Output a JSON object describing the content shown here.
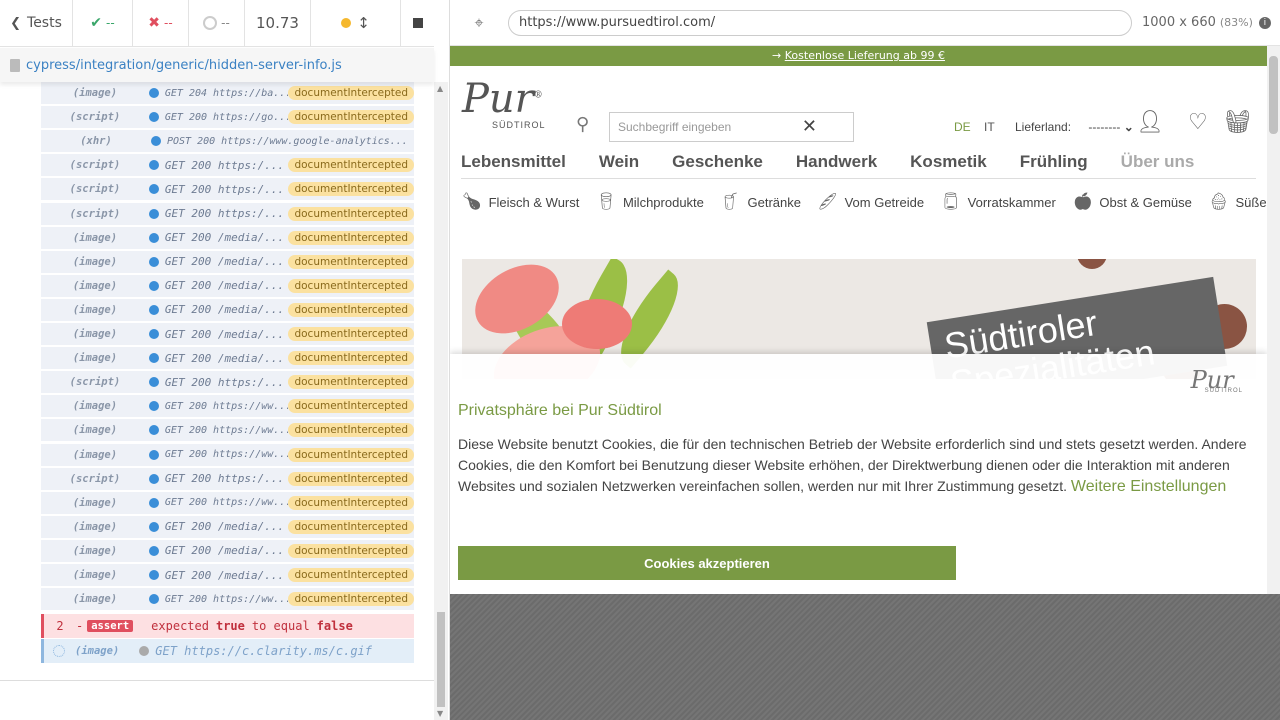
{
  "runner": {
    "tests_label": "Tests",
    "passed": "--",
    "failed": "--",
    "pending": "--",
    "duration": "10.73",
    "spec_path": "cypress/integration/generic/hidden-server-info.js"
  },
  "commands": [
    {
      "kind": "(image)",
      "req": "GET 204 https://ba...",
      "badge": "documentIntercepted",
      "small": true
    },
    {
      "kind": "(script)",
      "req": "GET 200 https://go...",
      "badge": "documentIntercepted",
      "small": true
    },
    {
      "kind": "(xhr)",
      "req": "POST 200 https://www.google-analytics...",
      "badge": "",
      "small": true
    },
    {
      "kind": "(script)",
      "req": "GET 200 https:/...",
      "badge": "documentIntercepted",
      "small": false
    },
    {
      "kind": "(script)",
      "req": "GET 200 https:/...",
      "badge": "documentIntercepted",
      "small": false
    },
    {
      "kind": "(script)",
      "req": "GET 200 https:/...",
      "badge": "documentIntercepted",
      "small": false
    },
    {
      "kind": "(image)",
      "req": "GET 200 /media/...",
      "badge": "documentIntercepted",
      "small": false
    },
    {
      "kind": "(image)",
      "req": "GET 200 /media/...",
      "badge": "documentIntercepted",
      "small": false
    },
    {
      "kind": "(image)",
      "req": "GET 200 /media/...",
      "badge": "documentIntercepted",
      "small": false
    },
    {
      "kind": "(image)",
      "req": "GET 200 /media/...",
      "badge": "documentIntercepted",
      "small": false
    },
    {
      "kind": "(image)",
      "req": "GET 200 /media/...",
      "badge": "documentIntercepted",
      "small": false
    },
    {
      "kind": "(image)",
      "req": "GET 200 /media/...",
      "badge": "documentIntercepted",
      "small": false
    },
    {
      "kind": "(script)",
      "req": "GET 200 https:/...",
      "badge": "documentIntercepted",
      "small": false
    },
    {
      "kind": "(image)",
      "req": "GET 200 https://ww...",
      "badge": "documentIntercepted",
      "small": true
    },
    {
      "kind": "(image)",
      "req": "GET 200 https://ww...",
      "badge": "documentIntercepted",
      "small": true
    },
    {
      "kind": "(image)",
      "req": "GET 200 https://ww...",
      "badge": "documentIntercepted",
      "small": true
    },
    {
      "kind": "(script)",
      "req": "GET 200 https:/...",
      "badge": "documentIntercepted",
      "small": false
    },
    {
      "kind": "(image)",
      "req": "GET 200 https://ww...",
      "badge": "documentIntercepted",
      "small": true
    },
    {
      "kind": "(image)",
      "req": "GET 200 /media/...",
      "badge": "documentIntercepted",
      "small": false
    },
    {
      "kind": "(image)",
      "req": "GET 200 /media/...",
      "badge": "documentIntercepted",
      "small": false
    },
    {
      "kind": "(image)",
      "req": "GET 200 /media/...",
      "badge": "documentIntercepted",
      "small": false
    },
    {
      "kind": "(image)",
      "req": "GET 200 https://ww...",
      "badge": "documentIntercepted",
      "small": true
    }
  ],
  "assert_row": {
    "number": "2",
    "dash": "-",
    "badge": "assert",
    "text_1": "expected",
    "value_1": "true",
    "text_2": "to equal",
    "value_2": "false"
  },
  "pending_row": {
    "kind": "(image)",
    "req": "GET https://c.clarity.ms/c.gif"
  },
  "aut": {
    "url": "https://www.pursuedtirol.com/",
    "viewport": "1000 x 660",
    "scale": "(83%)"
  },
  "site": {
    "promo_arrow": "→",
    "promo_link": "Kostenlose Lieferung ab 99 €",
    "logo_word": "Pur",
    "logo_reg": "®",
    "logo_sub": "SÜDTIROL",
    "search_placeholder": "Suchbegriff eingeben",
    "lang_de": "DE",
    "lang_it": "IT",
    "lieferland_label": "Lieferland:",
    "lieferland_value": "--------",
    "main_nav": [
      "Lebensmittel",
      "Wein",
      "Geschenke",
      "Handwerk",
      "Kosmetik",
      "Frühling",
      "Über uns"
    ],
    "sub_nav": [
      "Fleisch & Wurst",
      "Milchprodukte",
      "Getränke",
      "Vom Getreide",
      "Vorratskammer",
      "Obst & Gemüse",
      "Süßes"
    ],
    "hero_text_1": "Südtiroler",
    "hero_text_2": "Spezialitäten"
  },
  "cookie": {
    "logo": "Pur",
    "logo_sub": "SÜDTIROL",
    "title": "Privatsphäre bei Pur Südtirol",
    "body": "Diese Website benutzt Cookies, die für den technischen Betrieb der Website erforderlich sind und stets gesetzt werden. Andere Cookies, die den Komfort bei Benutzung dieser Website erhöhen, der Direktwerbung dienen oder die Interaktion mit anderen Websites und sozialen Netzwerken vereinfachen sollen, werden nur mit Ihrer Zustimmung gesetzt.",
    "more_link": "Weitere Einstellungen",
    "accept_button": "Cookies akzeptieren"
  },
  "colors": {
    "brand_green": "#7a9a44",
    "link_blue": "#3a81c3",
    "fail_red": "#e04f5f"
  }
}
